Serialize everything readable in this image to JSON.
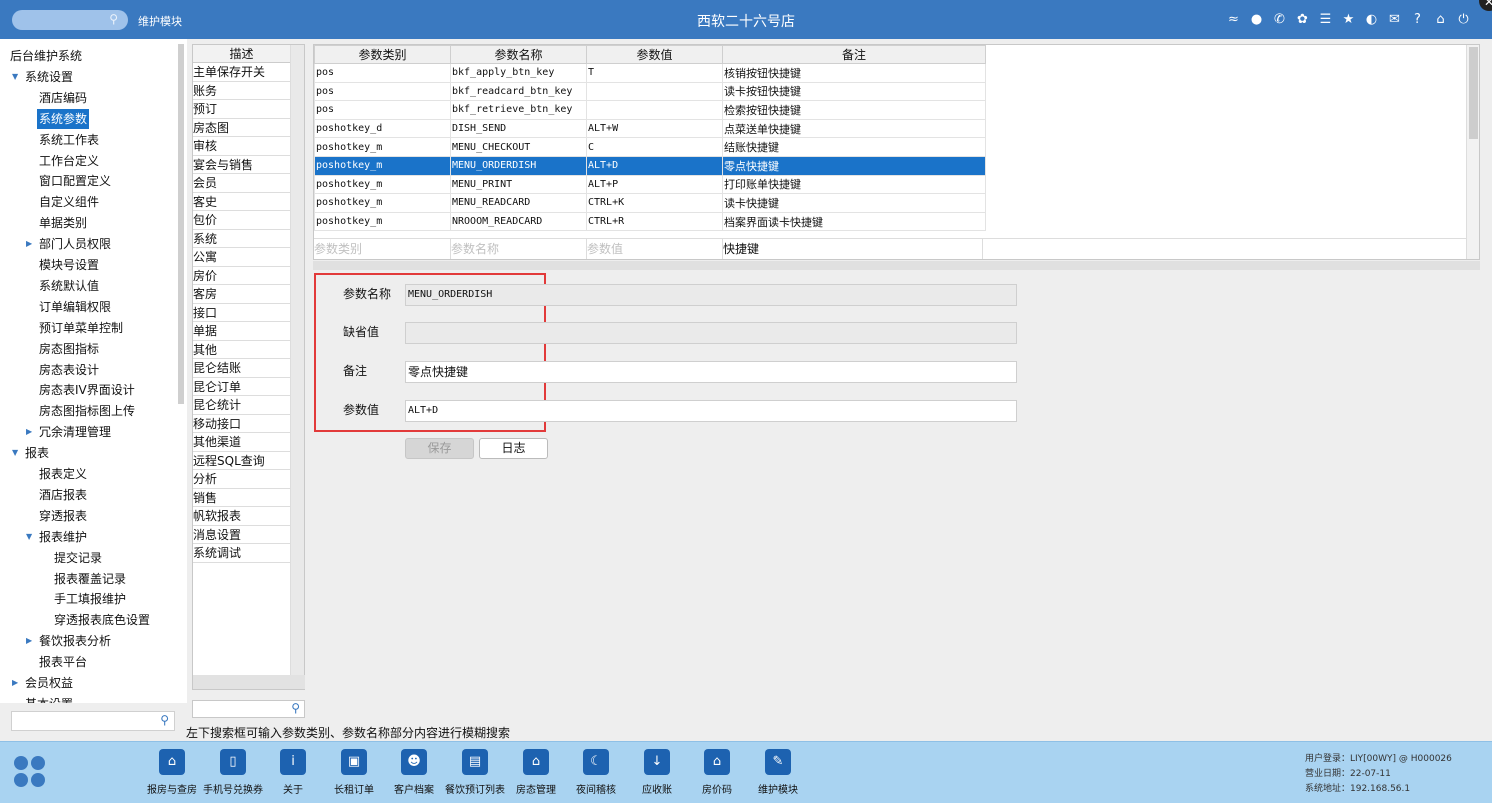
{
  "header": {
    "search_placeholder": "",
    "module_label": "维护模块",
    "title": "西软二十六号店",
    "icons": [
      "wifi-icon",
      "chat-icon",
      "phone-icon",
      "palette-icon",
      "menu-icon",
      "star-icon",
      "contrast-icon",
      "mail-icon",
      "help-icon",
      "home-icon",
      "power-icon"
    ]
  },
  "tree": [
    {
      "label": "后台维护系统",
      "level": 0,
      "arrow": ""
    },
    {
      "label": "系统设置",
      "level": 1,
      "arrow": "▼"
    },
    {
      "label": "酒店编码",
      "level": 2,
      "arrow": ""
    },
    {
      "label": "系统参数",
      "level": 2,
      "arrow": "",
      "selected": true
    },
    {
      "label": "系统工作表",
      "level": 2,
      "arrow": ""
    },
    {
      "label": "工作台定义",
      "level": 2,
      "arrow": ""
    },
    {
      "label": "窗口配置定义",
      "level": 2,
      "arrow": ""
    },
    {
      "label": "自定义组件",
      "level": 2,
      "arrow": ""
    },
    {
      "label": "单据类别",
      "level": 2,
      "arrow": ""
    },
    {
      "label": "部门人员权限",
      "level": 2,
      "arrow": "▶"
    },
    {
      "label": "模块号设置",
      "level": 2,
      "arrow": ""
    },
    {
      "label": "系统默认值",
      "level": 2,
      "arrow": ""
    },
    {
      "label": "订单编辑权限",
      "level": 2,
      "arrow": ""
    },
    {
      "label": "预订单菜单控制",
      "level": 2,
      "arrow": ""
    },
    {
      "label": "房态图指标",
      "level": 2,
      "arrow": ""
    },
    {
      "label": "房态表设计",
      "level": 2,
      "arrow": ""
    },
    {
      "label": "房态表IV界面设计",
      "level": 2,
      "arrow": ""
    },
    {
      "label": "房态图指标图上传",
      "level": 2,
      "arrow": ""
    },
    {
      "label": "冗余清理管理",
      "level": 2,
      "arrow": "▶"
    },
    {
      "label": "报表",
      "level": 1,
      "arrow": "▼"
    },
    {
      "label": "报表定义",
      "level": 2,
      "arrow": ""
    },
    {
      "label": "酒店报表",
      "level": 2,
      "arrow": ""
    },
    {
      "label": "穿透报表",
      "level": 2,
      "arrow": ""
    },
    {
      "label": "报表维护",
      "level": 2,
      "arrow": "▼"
    },
    {
      "label": "提交记录",
      "level": 3,
      "arrow": ""
    },
    {
      "label": "报表覆盖记录",
      "level": 3,
      "arrow": ""
    },
    {
      "label": "手工填报维护",
      "level": 3,
      "arrow": ""
    },
    {
      "label": "穿透报表底色设置",
      "level": 3,
      "arrow": ""
    },
    {
      "label": "餐饮报表分析",
      "level": 2,
      "arrow": "▶"
    },
    {
      "label": "报表平台",
      "level": 2,
      "arrow": ""
    },
    {
      "label": "会员权益",
      "level": 1,
      "arrow": "▶"
    },
    {
      "label": "基本设置",
      "level": 1,
      "arrow": ""
    }
  ],
  "tree_search_placeholder": "",
  "desc_panel": {
    "header": "描述",
    "items": [
      "主单保存开关",
      "账务",
      "预订",
      "房态图",
      "审核",
      "宴会与销售",
      "会员",
      "客史",
      "包价",
      "系统",
      "公寓",
      "房价",
      "客房",
      "接口",
      "单据",
      "其他",
      "昆仑结账",
      "昆仑订单",
      "昆仑统计",
      "移动接口",
      "其他渠道",
      "远程SQL查询",
      "分析",
      "销售",
      "帆软报表",
      "消息设置",
      "系统调试"
    ]
  },
  "grid": {
    "columns": [
      "参数类别",
      "参数名称",
      "参数值",
      "备注"
    ],
    "rows": [
      [
        "pos",
        "bkf_apply_btn_key",
        "T",
        "核销按钮快捷键"
      ],
      [
        "pos",
        "bkf_readcard_btn_key",
        "",
        "读卡按钮快捷键"
      ],
      [
        "pos",
        "bkf_retrieve_btn_key",
        "",
        "检索按钮快捷键"
      ],
      [
        "poshotkey_d",
        "DISH_SEND",
        "ALT+W",
        "点菜送单快捷键"
      ],
      [
        "poshotkey_m",
        "MENU_CHECKOUT",
        "C",
        "结账快捷键"
      ],
      [
        "poshotkey_m",
        "MENU_ORDERDISH",
        "ALT+D",
        "零点快捷键"
      ],
      [
        "poshotkey_m",
        "MENU_PRINT",
        "ALT+P",
        "打印账单快捷键"
      ],
      [
        "poshotkey_m",
        "MENU_READCARD",
        "CTRL+K",
        "读卡快捷键"
      ],
      [
        "poshotkey_m",
        "NROOOM_READCARD",
        "CTRL+R",
        "档案界面读卡快捷键"
      ]
    ],
    "selected_row": 5,
    "filters": [
      "参数类别",
      "参数名称",
      "参数值",
      "快捷键"
    ]
  },
  "form": {
    "name_label": "参数名称",
    "name_value": "MENU_ORDERDISH",
    "default_label": "缺省值",
    "default_value": "",
    "remark_label": "备注",
    "remark_value": "零点快捷键",
    "value_label": "参数值",
    "value_value": "ALT+D",
    "save_label": "保存",
    "log_label": "日志"
  },
  "hint": "左下搜索框可输入参数类别、参数名称部分内容进行模糊搜索",
  "bottom_bar": {
    "items": [
      {
        "label": "报房与查房",
        "icon": "house-icon"
      },
      {
        "label": "手机号兑换券码",
        "icon": "mobile-icon"
      },
      {
        "label": "关于",
        "icon": "info-icon"
      },
      {
        "label": "长租订单",
        "icon": "suitcase-icon"
      },
      {
        "label": "客户档案",
        "icon": "contact-card-icon"
      },
      {
        "label": "餐饮预订列表",
        "icon": "clipboard-icon"
      },
      {
        "label": "房态管理",
        "icon": "home-icon"
      },
      {
        "label": "夜间稽核",
        "icon": "moon-icon"
      },
      {
        "label": "应收账",
        "icon": "download-icon"
      },
      {
        "label": "房价码",
        "icon": "home-icon"
      },
      {
        "label": "维护模块",
        "icon": "wrench-icon"
      }
    ],
    "user_login": "用户登录：LIY[00WY] @ H000026",
    "business_date": "营业日期：22-07-11",
    "system_address": "系统地址：192.168.56.1"
  }
}
